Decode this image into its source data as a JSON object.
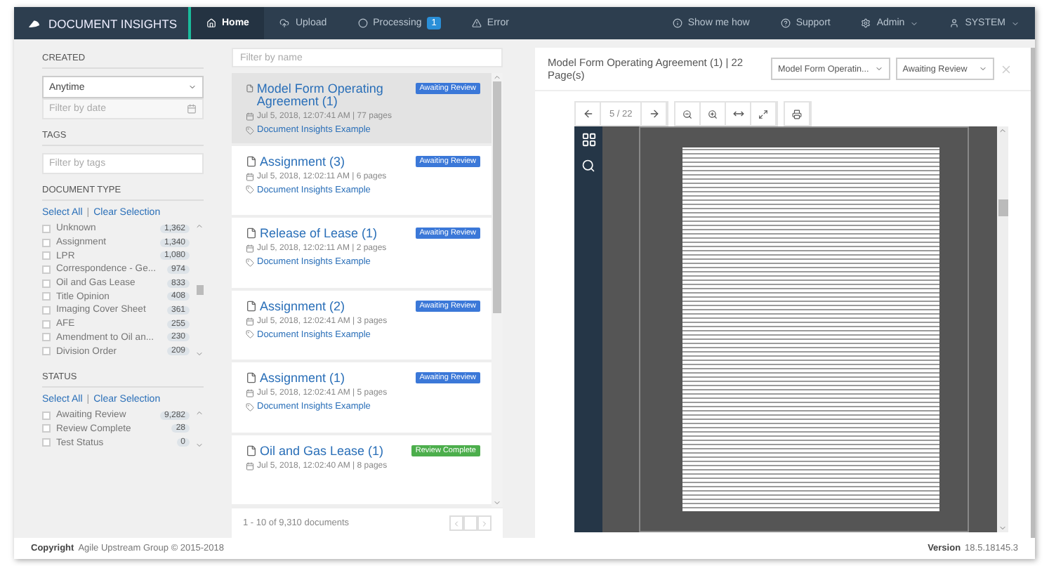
{
  "nav": {
    "brand": "DOCUMENT INSIGHTS",
    "left": [
      {
        "label": "Home",
        "selected": true
      },
      {
        "label": "Upload",
        "selected": false
      },
      {
        "label": "Processing",
        "selected": false,
        "badge": "1"
      },
      {
        "label": "Error",
        "selected": false
      }
    ],
    "right": [
      {
        "label": "Show me how",
        "dropdown": false
      },
      {
        "label": "Support",
        "dropdown": false
      },
      {
        "label": "Admin",
        "dropdown": true
      },
      {
        "label": "SYSTEM",
        "dropdown": true
      }
    ]
  },
  "sidebar": {
    "created": {
      "heading": "CREATED",
      "select": "Anytime",
      "date_placeholder": "Filter by date"
    },
    "tags": {
      "heading": "TAGS",
      "placeholder": "Filter by tags"
    },
    "document_type": {
      "heading": "DOCUMENT TYPE",
      "select_all": "Select All",
      "separator": "|",
      "clear": "Clear Selection",
      "items": [
        {
          "label": "Unknown",
          "count": "1,362",
          "checked": false
        },
        {
          "label": "Assignment",
          "count": "1,340",
          "checked": false
        },
        {
          "label": "LPR",
          "count": "1,080",
          "checked": false
        },
        {
          "label": "Correspondence - Ge...",
          "count": "974",
          "checked": false
        },
        {
          "label": "Oil and Gas Lease",
          "count": "833",
          "checked": false
        },
        {
          "label": "Title Opinion",
          "count": "408",
          "checked": false
        },
        {
          "label": "Imaging Cover Sheet",
          "count": "361",
          "checked": false
        },
        {
          "label": "AFE",
          "count": "255",
          "checked": false
        },
        {
          "label": "Amendment to Oil an...",
          "count": "230",
          "checked": false
        },
        {
          "label": "Division Order",
          "count": "209",
          "checked": false
        }
      ]
    },
    "status": {
      "heading": "STATUS",
      "select_all": "Select All",
      "separator": "|",
      "clear": "Clear Selection",
      "items": [
        {
          "label": "Awaiting Review",
          "count": "9,282",
          "checked": false
        },
        {
          "label": "Review Complete",
          "count": "28",
          "checked": false
        },
        {
          "label": "Test Status",
          "count": "0",
          "checked": false
        }
      ]
    }
  },
  "documents": {
    "placeholder": "Filter by name",
    "items": [
      {
        "title": "Model Form Operating Agreement (1)",
        "meta": "Jul 5, 2018, 12:07:41 AM | 77 pages",
        "link": "Document Insights Example",
        "status": "Awaiting Review",
        "kind": "awaiting",
        "selected": true
      },
      {
        "title": "Assignment (3)",
        "meta": "Jul 5, 2018, 12:02:11 AM | 6 pages",
        "link": "Document Insights Example",
        "status": "Awaiting Review",
        "kind": "awaiting",
        "selected": false
      },
      {
        "title": "Release of Lease (1)",
        "meta": "Jul 5, 2018, 12:02:11 AM | 2 pages",
        "link": "Document Insights Example",
        "status": "Awaiting Review",
        "kind": "awaiting",
        "selected": false
      },
      {
        "title": "Assignment (2)",
        "meta": "Jul 5, 2018, 12:02:41 AM | 3 pages",
        "link": "Document Insights Example",
        "status": "Awaiting Review",
        "kind": "awaiting",
        "selected": false
      },
      {
        "title": "Assignment (1)",
        "meta": "Jul 5, 2018, 12:02:41 AM | 5 pages",
        "link": "Document Insights Example",
        "status": "Awaiting Review",
        "kind": "awaiting",
        "selected": false
      },
      {
        "title": "Oil and Gas Lease (1)",
        "meta": "Jul 5, 2018, 12:02:40 AM | 8 pages",
        "status": "Review Complete",
        "kind": "complete",
        "selected": false
      }
    ],
    "summary": "1 - 10 of 9,310 documents"
  },
  "viewer": {
    "title": "Model Form Operating Agreement (1) | 22 Page(s)",
    "type_select": "Model Form Operatin...",
    "status_select": "Awaiting Review",
    "page": "5 / 22"
  },
  "footer": {
    "copyright_label": "Copyright",
    "copyright": "Agile Upstream Group © 2015-2018",
    "version_label": "Version",
    "version": "18.5.18145.3"
  }
}
